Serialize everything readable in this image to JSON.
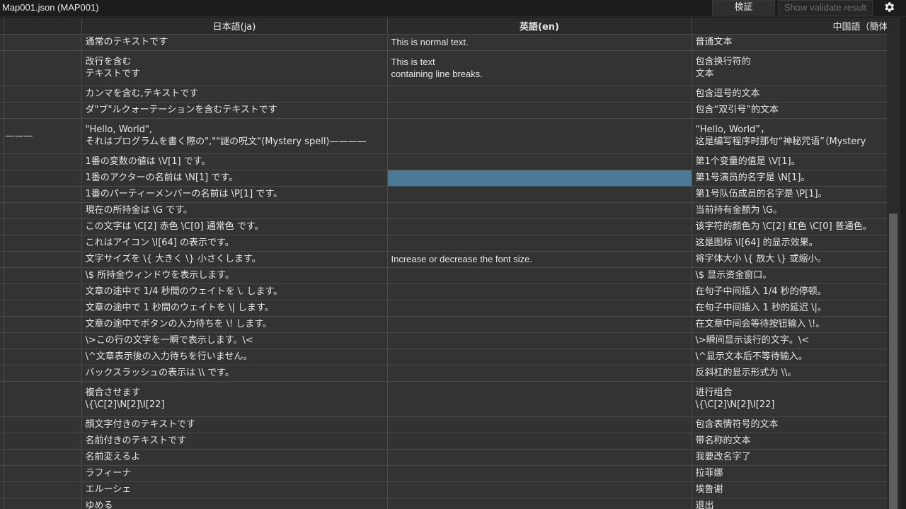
{
  "window": {
    "title": "Map001.json (MAP001)",
    "validate_label": "検証",
    "show_validate_label": "Show validate result",
    "settings_icon": "gear-icon"
  },
  "columns": {
    "ja": "日本語(ja)",
    "en": "英語(en)",
    "zh": "中国語（簡体）(zh-c"
  },
  "rows": [
    {
      "id": "",
      "ja": "通常のテキストです",
      "en": "This is normal text.",
      "zh": "普通文本"
    },
    {
      "id": "",
      "ja": "改行を含む\nテキストです",
      "en": "This is text\ncontaining line breaks.",
      "zh": "包含换行符的\n文本"
    },
    {
      "id": "",
      "ja": "カンマを含む,テキストです",
      "en": "",
      "zh": "包含逗号的文本"
    },
    {
      "id": "",
      "ja": "ダ\"ブ\"ルクォーテーションを含むテキストです",
      "en": "",
      "zh": "包含“双引号”的文本"
    },
    {
      "id": "———",
      "ja": "\"Hello, World\",\nそれはプログラムを書く際の\",\"\"謎の呪文\"(Mystery spell)————",
      "en": "",
      "zh": "“Hello, World”，\n这是编写程序时那句“神秘咒语”（Mystery"
    },
    {
      "id": "",
      "ja": "1番の変数の値は \\V[1] です。",
      "en": "",
      "zh": "第1个变量的值是 \\V[1]。"
    },
    {
      "id": "",
      "ja": "1番のアクターの名前は \\N[1] です。",
      "en": "",
      "zh": "第1号演员的名字是 \\N[1]。",
      "selected": true
    },
    {
      "id": "",
      "ja": "1番のパーティーメンバーの名前は \\P[1] です。",
      "en": "",
      "zh": "第1号队伍成员的名字是 \\P[1]。"
    },
    {
      "id": "",
      "ja": "現在の所持金は \\G です。",
      "en": "",
      "zh": "当前持有金额为 \\G。"
    },
    {
      "id": "",
      "ja": "この文字は \\C[2] 赤色 \\C[0] 通常色 です。",
      "en": "",
      "zh": "该字符的颜色为 \\C[2] 红色 \\C[0] 普通色。"
    },
    {
      "id": "",
      "ja": "これはアイコン \\I[64] の表示です。",
      "en": "",
      "zh": "这是图标 \\I[64] 的显示效果。"
    },
    {
      "id": "",
      "ja": "文字サイズを \\{ 大きく \\} 小さくします。",
      "en": "Increase or decrease the font size.",
      "zh": "将字体大小 \\{ 放大 \\} 或缩小。"
    },
    {
      "id": "",
      "ja": "\\$ 所持金ウィンドウを表示します。",
      "en": "",
      "zh": "\\$ 显示资金窗口。"
    },
    {
      "id": "",
      "ja": "文章の途中で 1/4 秒間のウェイトを \\. します。",
      "en": "",
      "zh": "在句子中间插入 1/4 秒的停顿。"
    },
    {
      "id": "",
      "ja": "文章の途中で 1 秒間のウェイトを \\| します。",
      "en": "",
      "zh": "在句子中间插入 1 秒的延迟 \\|。"
    },
    {
      "id": "",
      "ja": "文章の途中でボタンの入力待ちを \\! します。",
      "en": "",
      "zh": "在文章中间会等待按钮输入 \\!。"
    },
    {
      "id": "",
      "ja": "\\>この行の文字を一瞬で表示します。\\<",
      "en": "",
      "zh": "\\>瞬间显示该行的文字。\\<"
    },
    {
      "id": "",
      "ja": "\\^文章表示後の入力待ちを行いません。",
      "en": "",
      "zh": "\\^显示文本后不等待输入。"
    },
    {
      "id": "",
      "ja": "バックスラッシュの表示は \\\\ です。",
      "en": "",
      "zh": "反斜杠的显示形式为 \\\\。"
    },
    {
      "id": "",
      "ja": "複合させます\n\\{\\C[2]\\N[2]\\I[22]",
      "en": "",
      "zh": "进行组合\n\\{\\C[2]\\N[2]\\I[22]"
    },
    {
      "id": "",
      "ja": "顔文字付きのテキストです",
      "en": "",
      "zh": "包含表情符号的文本"
    },
    {
      "id": "",
      "ja": "名前付きのテキストです",
      "en": "",
      "zh": "带名称的文本"
    },
    {
      "id": "",
      "ja": "名前変えるよ",
      "en": "",
      "zh": "我要改名字了"
    },
    {
      "id": "",
      "ja": "ラフィーナ",
      "en": "",
      "zh": "拉菲娜"
    },
    {
      "id": "",
      "ja": "エルーシェ",
      "en": "",
      "zh": "埃鲁谢"
    },
    {
      "id": "",
      "ja": "ゆめる",
      "en": "",
      "zh": "退出"
    }
  ]
}
